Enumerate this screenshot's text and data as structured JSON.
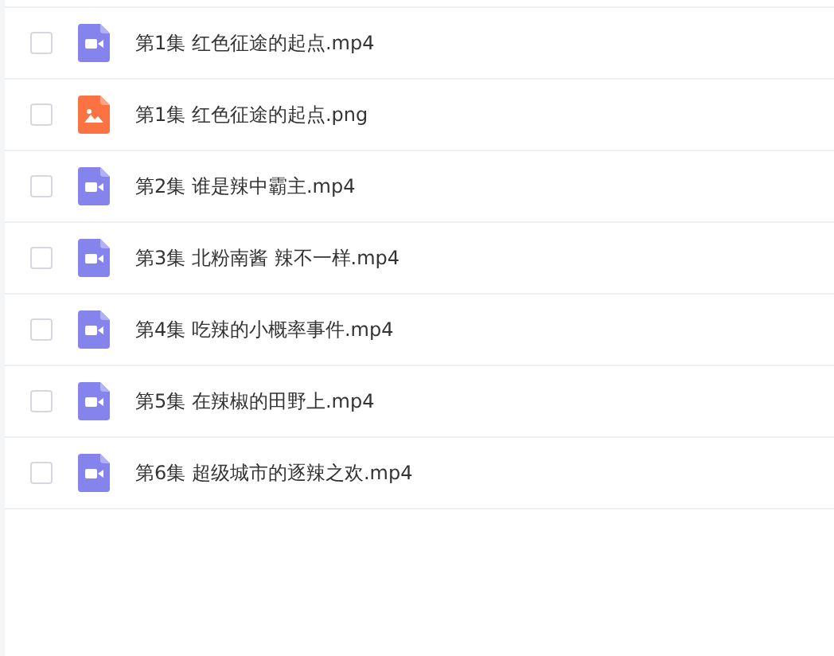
{
  "files": [
    {
      "name": "第1集 红色征途的起点.mp4",
      "kind": "video",
      "checked": false
    },
    {
      "name": "第1集 红色征途的起点.png",
      "kind": "image",
      "checked": false
    },
    {
      "name": "第2集 谁是辣中霸主.mp4",
      "kind": "video",
      "checked": false
    },
    {
      "name": "第3集 北粉南酱 辣不一样.mp4",
      "kind": "video",
      "checked": false
    },
    {
      "name": "第4集 吃辣的小概率事件.mp4",
      "kind": "video",
      "checked": false
    },
    {
      "name": "第5集 在辣椒的田野上.mp4",
      "kind": "video",
      "checked": false
    },
    {
      "name": "第6集 超级城市的逐辣之欢.mp4",
      "kind": "video",
      "checked": false
    }
  ]
}
